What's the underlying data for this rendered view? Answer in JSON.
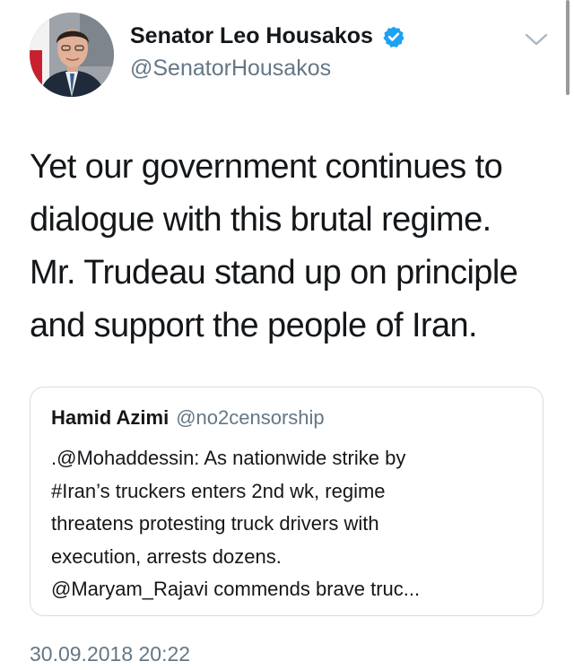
{
  "author": {
    "display_name": "Senator Leo Housakos",
    "handle": "@SenatorHousakos",
    "verified": true
  },
  "tweet": {
    "lines": [
      "Yet our government continues to",
      "dialogue with this brutal regime.",
      "Mr. Trudeau stand up on principle",
      "and support the people of Iran."
    ],
    "timestamp": "30.09.2018 20:22"
  },
  "quoted_tweet": {
    "display_name": "Hamid Azimi",
    "handle": "@no2censorship",
    "lines": [
      ".@Mohaddessin: As nationwide strike by",
      "#Iran’s truckers enters 2nd wk, regime",
      "threatens protesting truck drivers with",
      "execution, arrests dozens.",
      "@Maryam_Rajavi commends brave truc..."
    ]
  },
  "icons": {
    "verified": "verified-badge-icon",
    "menu": "chevron-down-icon"
  },
  "colors": {
    "verified_blue": "#1da1f2",
    "secondary_text": "#657786",
    "primary_text": "#14171a",
    "card_border": "#d6dde3"
  }
}
